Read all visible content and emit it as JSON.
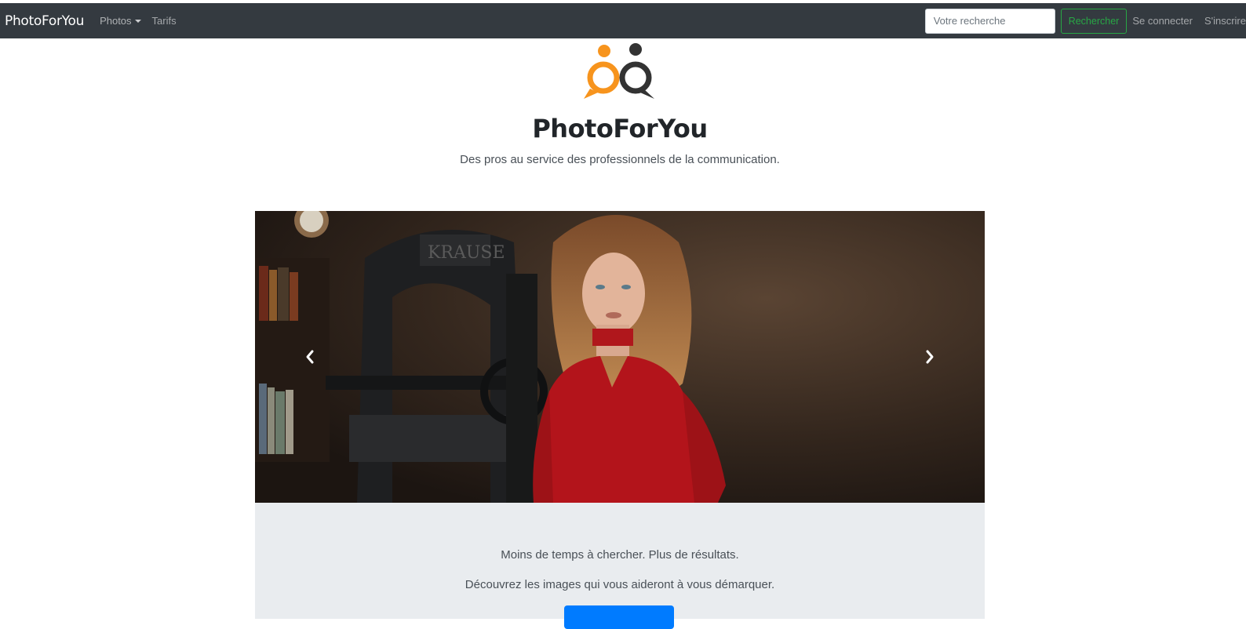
{
  "navbar": {
    "brand": "PhotoForYou",
    "photos_label": "Photos",
    "tarifs_label": "Tarifs",
    "search_placeholder": "Votre recherche",
    "search_button": "Rechercher",
    "login_label": "Se connecter",
    "signup_label": "S'inscrire"
  },
  "hero": {
    "title": "PhotoForYou",
    "tagline": "Des pros au service des professionnels de la communication."
  },
  "carousel": {
    "prev_icon": "chevron-left-icon",
    "next_icon": "chevron-right-icon"
  },
  "info": {
    "line1": "Moins de temps à chercher. Plus de résultats.",
    "line2": "Découvrez les images qui vous aideront à vous démarquer."
  },
  "colors": {
    "navbar_bg": "#343a40",
    "accent_green": "#28a745",
    "logo_orange": "#f7941d",
    "logo_dark": "#333333",
    "primary_blue": "#007bff",
    "info_bg": "#e9ecef"
  }
}
